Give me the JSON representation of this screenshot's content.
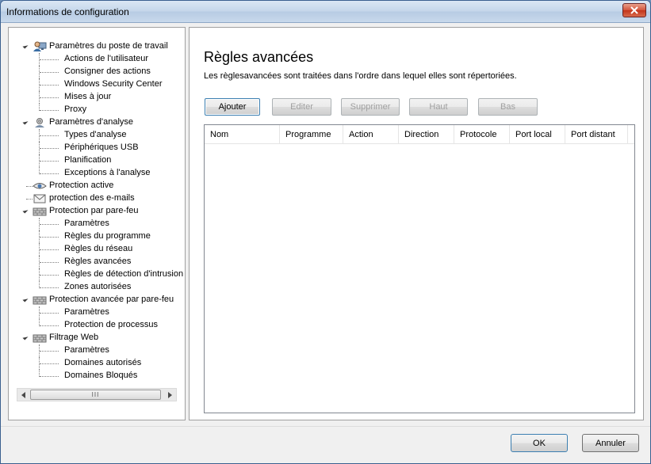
{
  "window": {
    "title": "Informations de configuration"
  },
  "colors": {
    "title_bar": "#c4d6ea",
    "close_button": "#c3341a",
    "panel_border": "#a0a0a0",
    "button_focus": "#3c7fb1"
  },
  "tree": {
    "items": [
      {
        "label": "Paramètres du poste de travail",
        "level": 0,
        "icon": "computer-user-icon",
        "expanded": true
      },
      {
        "label": "Actions de l'utilisateur",
        "level": 1
      },
      {
        "label": "Consigner des actions",
        "level": 1
      },
      {
        "label": "Windows Security Center",
        "level": 1
      },
      {
        "label": "Mises à jour",
        "level": 1
      },
      {
        "label": "Proxy",
        "level": 1
      },
      {
        "label": "Paramètres d'analyse",
        "level": 0,
        "icon": "scan-settings-icon",
        "expanded": true
      },
      {
        "label": "Types d'analyse",
        "level": 1
      },
      {
        "label": "Périphériques USB",
        "level": 1
      },
      {
        "label": "Planification",
        "level": 1
      },
      {
        "label": "Exceptions à l'analyse",
        "level": 1
      },
      {
        "label": "Protection active",
        "level": 0,
        "icon": "eye-icon"
      },
      {
        "label": "protection des e-mails",
        "level": 0,
        "icon": "envelope-icon"
      },
      {
        "label": "Protection par pare-feu",
        "level": 0,
        "icon": "firewall-icon",
        "expanded": true
      },
      {
        "label": "Paramètres",
        "level": 1
      },
      {
        "label": "Règles du programme",
        "level": 1
      },
      {
        "label": "Règles du réseau",
        "level": 1
      },
      {
        "label": "Règles avancées",
        "level": 1
      },
      {
        "label": "Règles de détection d'intrusion",
        "level": 1
      },
      {
        "label": "Zones autorisées",
        "level": 1
      },
      {
        "label": "Protection avancée par pare-feu",
        "level": 0,
        "icon": "firewall-icon",
        "expanded": true
      },
      {
        "label": "Paramètres",
        "level": 1
      },
      {
        "label": "Protection de processus",
        "level": 1
      },
      {
        "label": "Filtrage Web",
        "level": 0,
        "icon": "firewall-icon",
        "expanded": true
      },
      {
        "label": "Paramètres",
        "level": 1
      },
      {
        "label": "Domaines autorisés",
        "level": 1
      },
      {
        "label": "Domaines Bloqués",
        "level": 1
      }
    ],
    "scroll_thumb_grip": "III"
  },
  "main": {
    "heading": "Règles avancées",
    "description": "Les règlesavancées  sont traitées dans l'ordre dans lequel elles sont répertoriées.",
    "buttons": {
      "add": "Ajouter",
      "edit": "Editer",
      "delete": "Supprimer",
      "up": "Haut",
      "down": "Bas"
    },
    "table": {
      "columns": [
        "Nom",
        "Programme",
        "Action",
        "Direction",
        "Protocole",
        "Port local",
        "Port distant"
      ],
      "rows": []
    }
  },
  "footer": {
    "ok": "OK",
    "cancel": "Annuler"
  }
}
